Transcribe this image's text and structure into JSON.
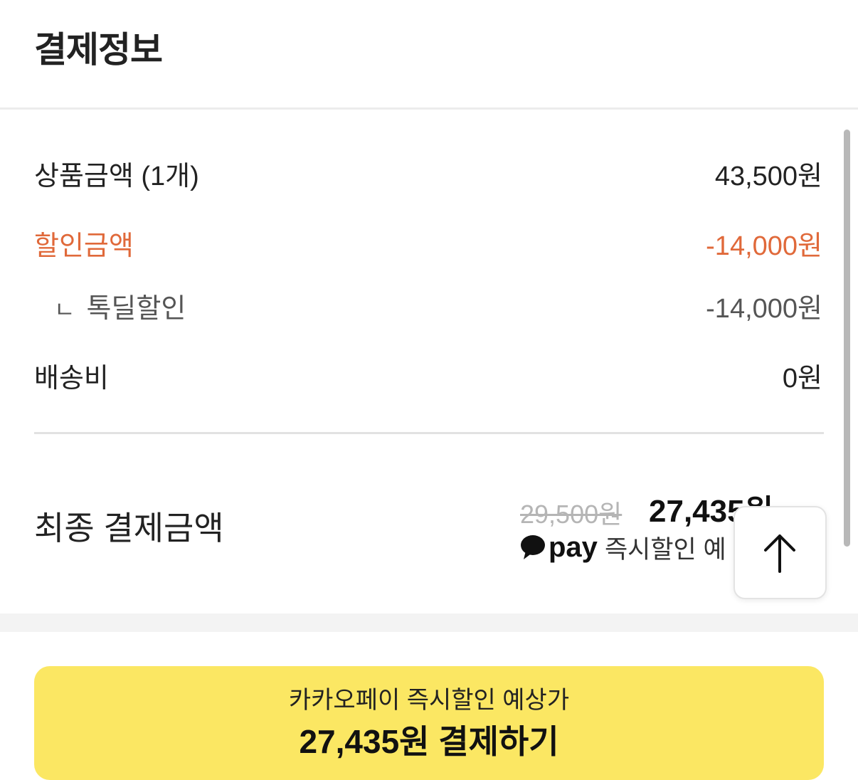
{
  "header": {
    "title": "결제정보"
  },
  "rows": [
    {
      "label": "상품금액 (1개)",
      "value": "43,500원"
    },
    {
      "label": "할인금액",
      "value": "-14,000원"
    },
    {
      "marker": "ㄴ",
      "label": "톡딜할인",
      "value": "-14,000원"
    },
    {
      "label": "배송비",
      "value": "0원"
    }
  ],
  "final": {
    "label": "최종 결제금액",
    "original_price": "29,500원",
    "final_price": "27,435원",
    "pay_word": "pay",
    "pay_text": "즉시할인 예"
  },
  "cta": {
    "line1": "카카오페이 즉시할인 예상가",
    "line2": "27,435원 결제하기"
  },
  "colors": {
    "discount": "#e0693a",
    "cta_background": "#fbe763"
  },
  "icons": {
    "scroll_top": "arrow-up-icon",
    "pay": "speech-bubble-icon"
  }
}
